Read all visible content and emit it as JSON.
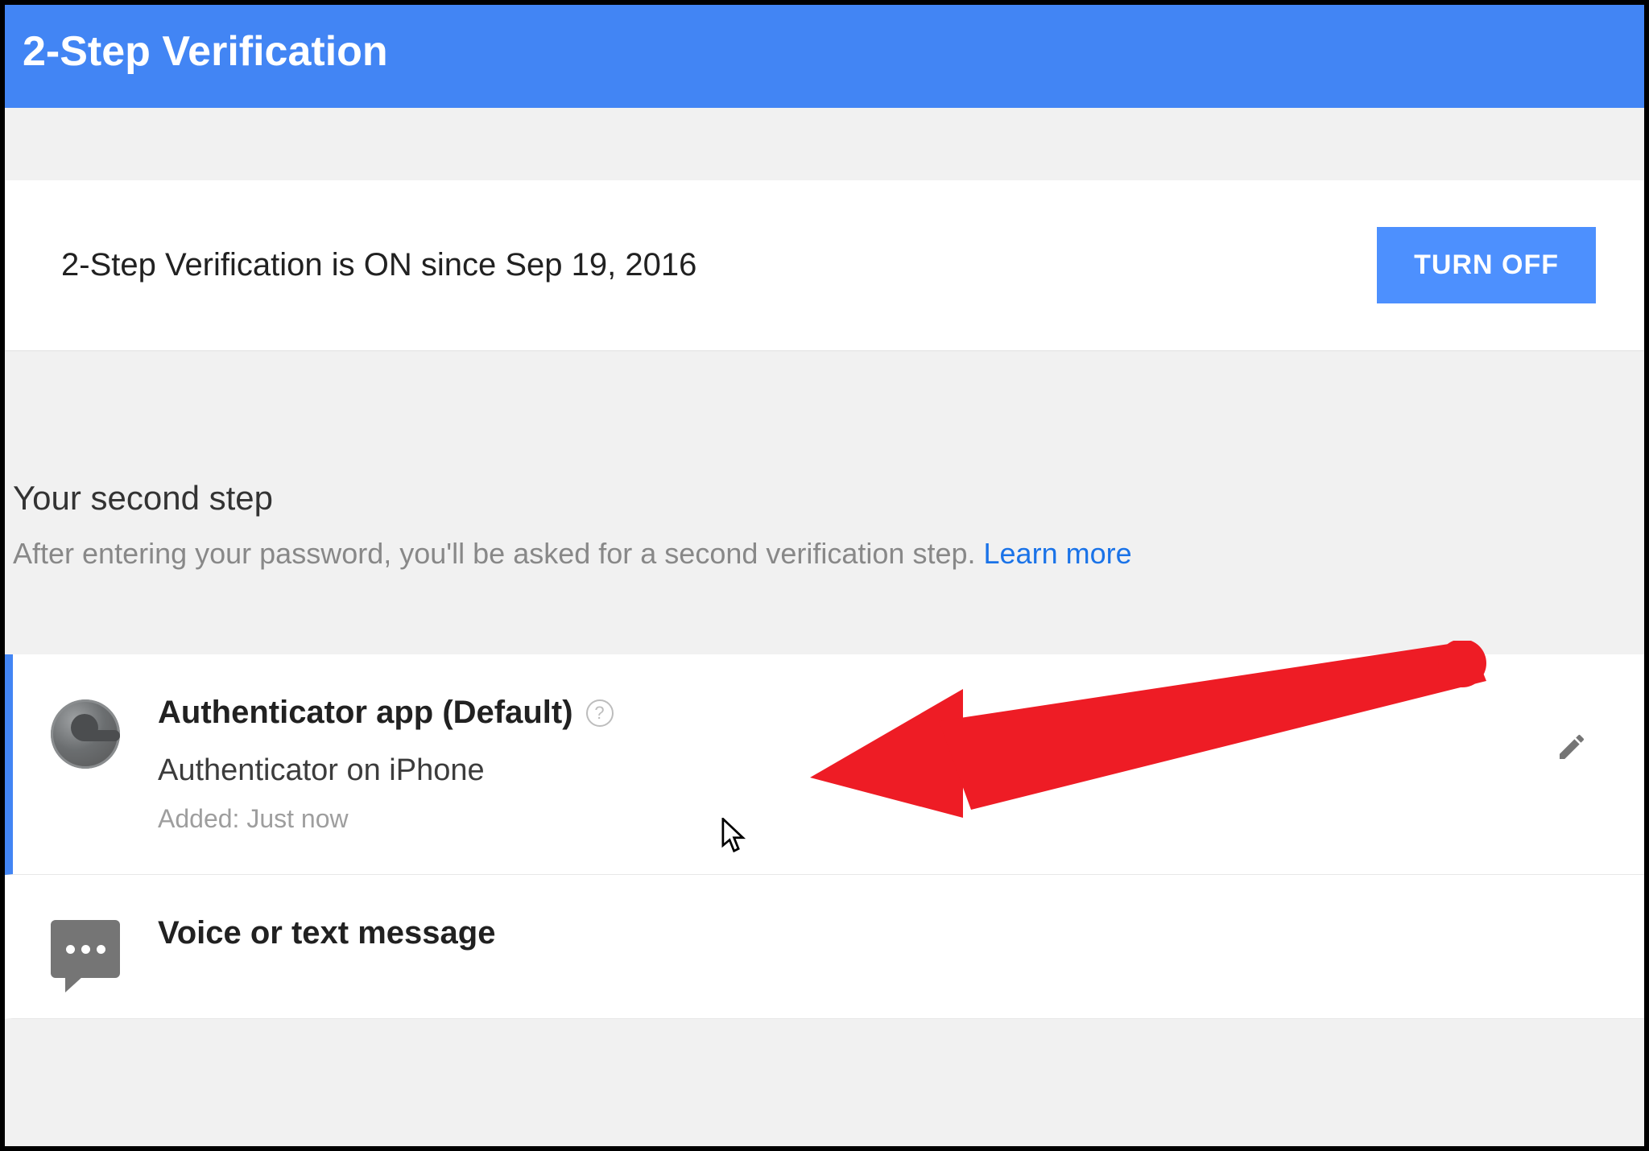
{
  "header": {
    "title": "2-Step Verification"
  },
  "status": {
    "text": "2-Step Verification is ON since Sep 19, 2016",
    "turn_off_label": "TURN OFF"
  },
  "section": {
    "title": "Your second step",
    "description": "After entering your password, you'll be asked for a second verification step. ",
    "learn_more": "Learn more"
  },
  "methods": [
    {
      "title": "Authenticator app (Default)",
      "subtitle": "Authenticator on iPhone",
      "meta": "Added: Just now"
    },
    {
      "title": "Voice or text message"
    }
  ]
}
